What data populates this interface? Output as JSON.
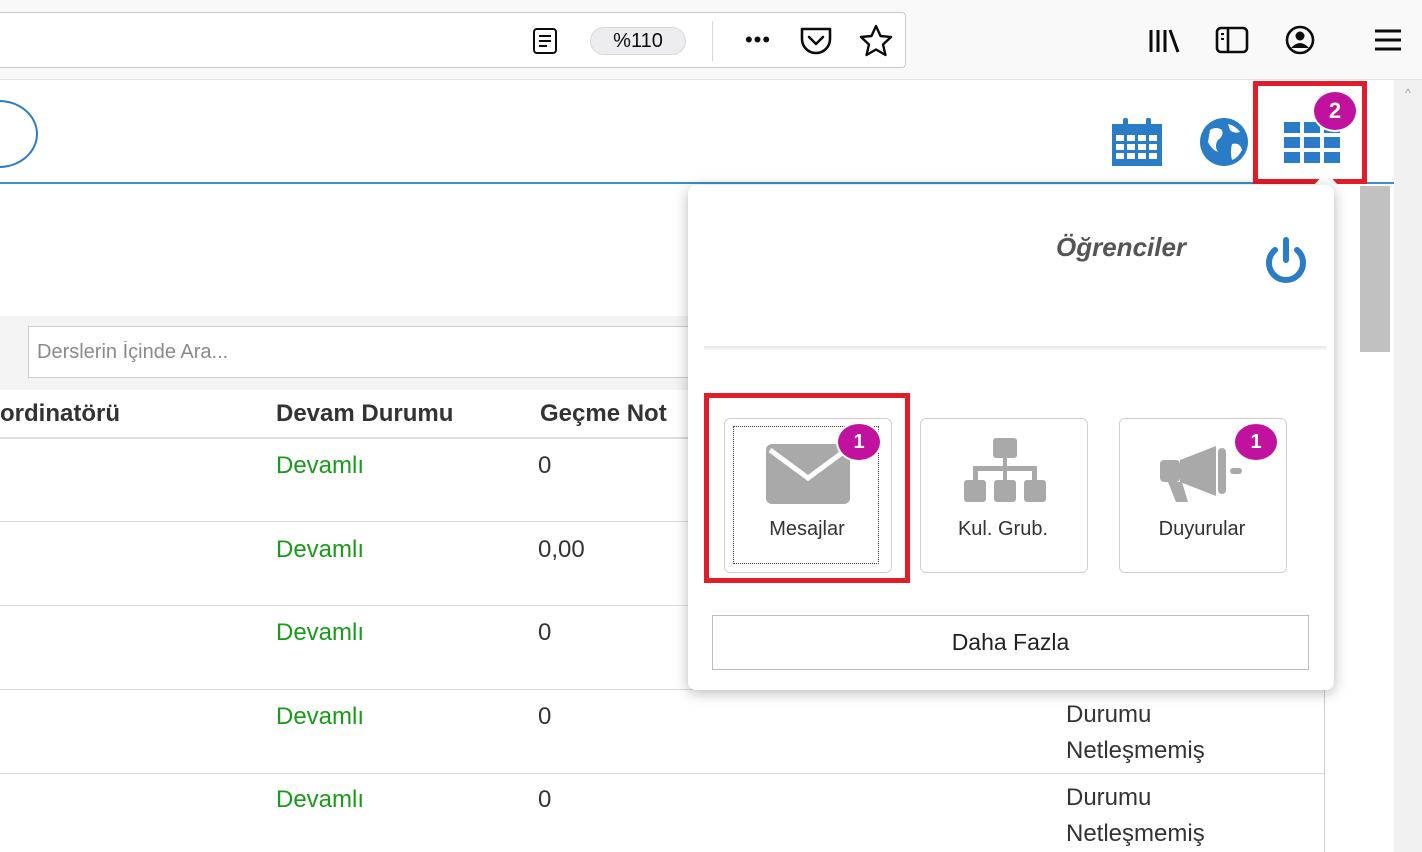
{
  "browser": {
    "zoom": "%110",
    "overflow_dots": "•••"
  },
  "search": {
    "placeholder": "Derslerin İçinde Ara..."
  },
  "table": {
    "headers": [
      "ordinatörü",
      "Devam Durumu",
      "Geçme Not"
    ],
    "rows": [
      {
        "status": "Devamlı",
        "grade": "0",
        "note": ""
      },
      {
        "status": "Devamlı",
        "grade": "0,00",
        "note": ""
      },
      {
        "status": "Devamlı",
        "grade": "0",
        "note": ""
      },
      {
        "status": "Devamlı",
        "grade": "0",
        "note": "Durumu Netleşmemiş"
      },
      {
        "status": "Devamlı",
        "grade": "0",
        "note": "Durumu Netleşmemiş"
      }
    ],
    "status_color": "#1a9a1a"
  },
  "header_icons": {
    "apps_badge": "2",
    "icons": [
      "calendar-icon",
      "globe-icon",
      "apps-grid-icon"
    ]
  },
  "panel": {
    "user_label": "Öğrenciler",
    "tiles": [
      {
        "label": "Mesajlar",
        "badge": "1",
        "icon": "envelope-icon"
      },
      {
        "label": "Kul. Grub.",
        "badge": "",
        "icon": "org-chart-icon"
      },
      {
        "label": "Duyurular",
        "badge": "1",
        "icon": "megaphone-icon"
      }
    ],
    "more_label": "Daha Fazla"
  },
  "colors": {
    "accent_blue": "#2a7cc7",
    "badge_magenta": "#c0119f",
    "highlight_red": "#e11d2a"
  }
}
